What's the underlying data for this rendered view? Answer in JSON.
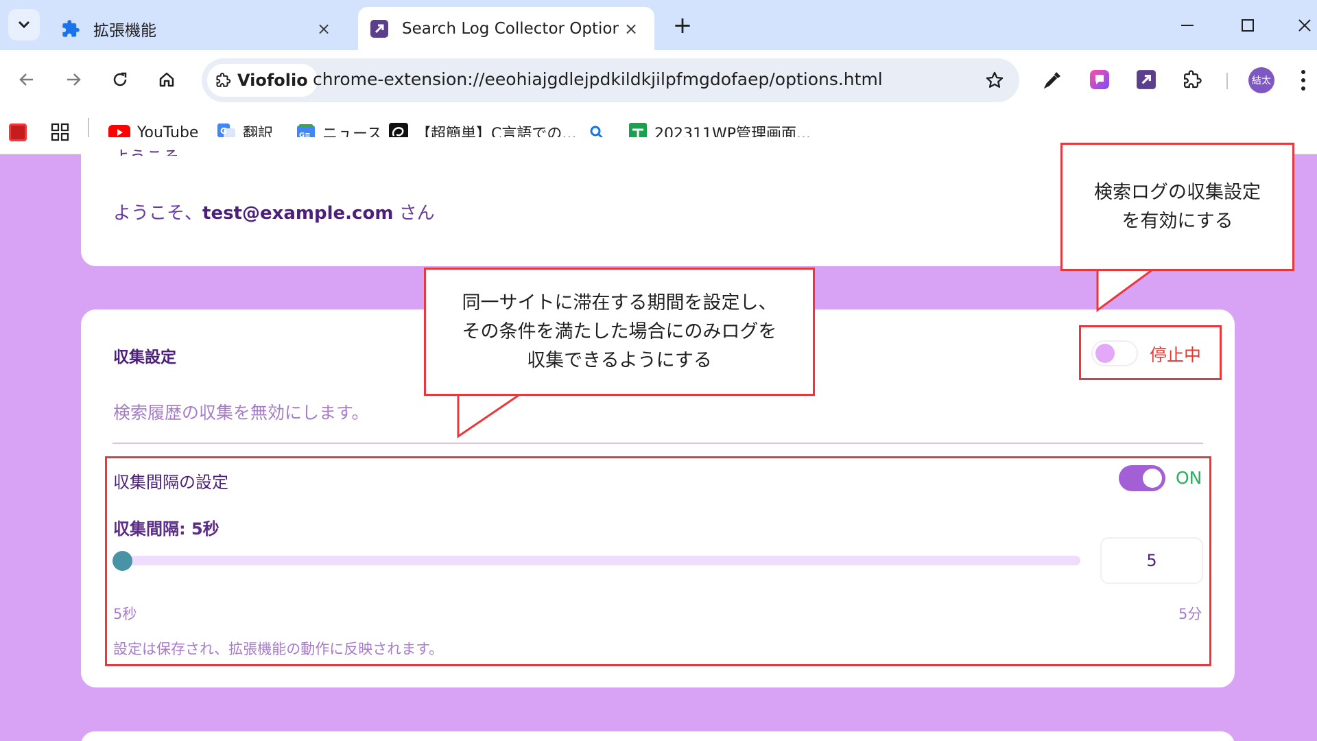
{
  "browser": {
    "tabs": [
      {
        "title": "拡張機能",
        "icon": "puzzle-icon",
        "close": "×"
      },
      {
        "title": "Search Log Collector Options",
        "icon": "extension-icon",
        "close": "×"
      }
    ],
    "new_tab": "+",
    "site_chip": "Viofolio",
    "url": "chrome-extension://eeohiajgdlejpdkildkjilpfmgdofaep/options.html",
    "avatar_text": "結太",
    "bookmarks": [
      {
        "label": "YouTube",
        "icon": "youtube-icon"
      },
      {
        "label": "翻訳",
        "icon": "translate-icon"
      },
      {
        "label": "ニュース",
        "icon": "news-icon"
      },
      {
        "label": "【超簡単】C言語での...",
        "icon": "site-icon"
      },
      {
        "label": "",
        "icon": "search-icon"
      },
      {
        "label": "202311WP管理画面...",
        "icon": "sheets-icon"
      }
    ]
  },
  "page": {
    "welcome_heading": "ようこそ",
    "welcome_prefix": "ようこそ、",
    "welcome_email": "test@example.com",
    "welcome_suffix": " さん",
    "collection": {
      "title": "収集設定",
      "description": "検索履歴の収集を無効にします。",
      "toggle_on": false,
      "status": "停止中",
      "status_color": "#e53935"
    },
    "interval": {
      "title": "収集間隔の設定",
      "toggle_on": true,
      "status": "ON",
      "status_color": "#21b35a",
      "value_label": "収集間隔: 5秒",
      "input_value": "5",
      "slider_fraction": 0,
      "min_label": "5秒",
      "max_label": "5分",
      "note": "設定は保存され、拡張機能の動作に反映されます。"
    }
  },
  "annotations": {
    "callout_toggle": "検索ログの収集設定\nを有効にする",
    "callout_interval": "同一サイトに滞在する期間を設定し、\nその条件を満たした場合にのみログを\n収集できるようにする",
    "highlight_color": "#e8383d"
  },
  "colors": {
    "page_background": "#d9a3f5",
    "accent": "#a25fd6",
    "slider_thumb": "#4893a6"
  }
}
